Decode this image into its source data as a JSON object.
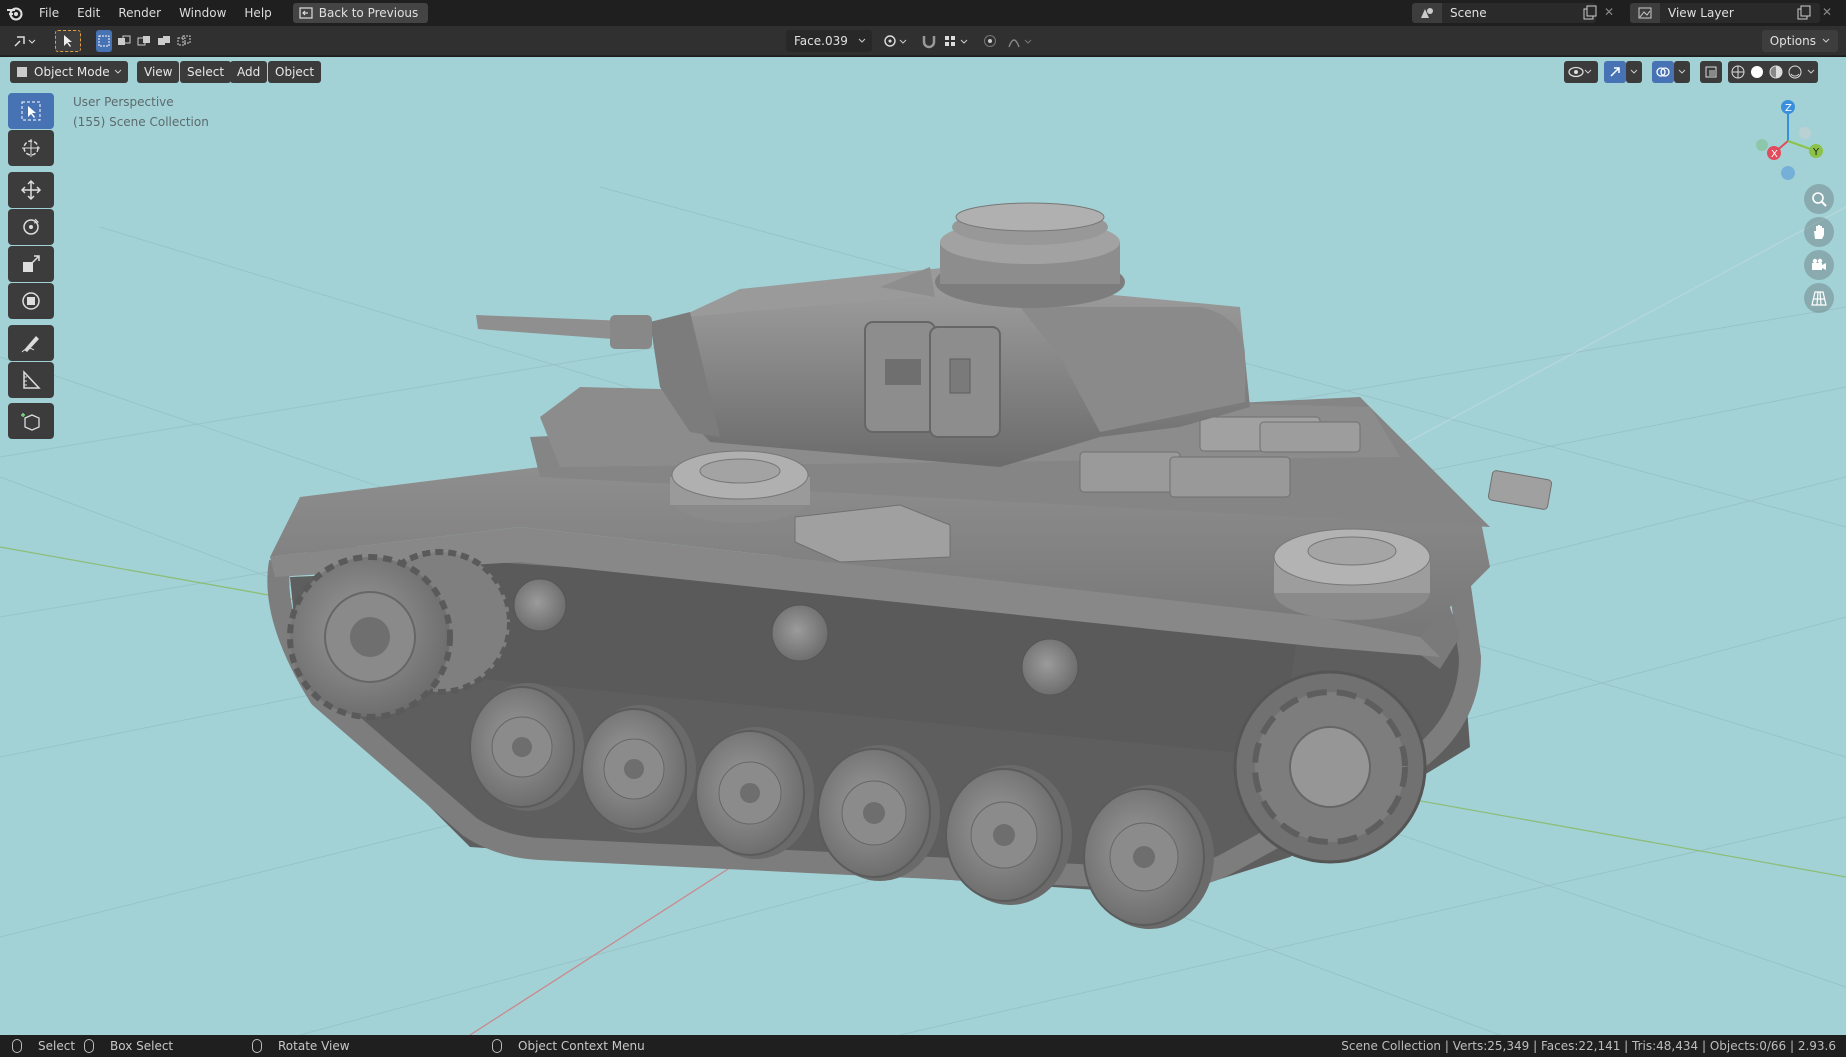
{
  "menu": {
    "items": [
      "File",
      "Edit",
      "Render",
      "Window",
      "Help"
    ],
    "back_label": "Back to Previous"
  },
  "scene": {
    "label": "Scene"
  },
  "view_layer": {
    "label": "View Layer"
  },
  "toolbar": {
    "face_dropdown": "Face.039",
    "options_label": "Options"
  },
  "viewport": {
    "mode_label": "Object Mode",
    "menus": [
      "View",
      "Select",
      "Add",
      "Object"
    ],
    "overlay_title": "User Perspective",
    "overlay_collection": "(155) Scene Collection",
    "background_color": "#a3d2d6",
    "axis_colors": {
      "x": "#e24b5c",
      "y": "#8bc34a",
      "z": "#3a8fdc"
    }
  },
  "tools": [
    "select-box",
    "cursor",
    "move",
    "rotate",
    "scale",
    "transform",
    "annotate",
    "measure",
    "add-cube"
  ],
  "nav_icons": [
    "zoom-icon",
    "pan-hand-icon",
    "camera-icon",
    "grid-icon"
  ],
  "statusbar": {
    "select": "Select",
    "box_select": "Box Select",
    "rotate_view": "Rotate View",
    "context_menu": "Object Context Menu",
    "stats": "Scene Collection | Verts:25,349 | Faces:22,141 | Tris:48,434 | Objects:0/66 | 2.93.6"
  }
}
